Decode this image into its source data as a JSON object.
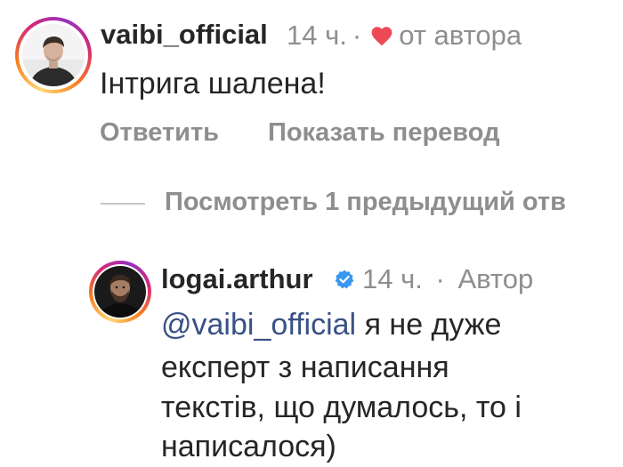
{
  "comments": [
    {
      "username": "vaibi_official",
      "time": "14 ч.",
      "separator": "·",
      "liked_by_author_label": "от автора",
      "text": "Інтрига шалена!",
      "actions": {
        "reply": "Ответить",
        "translate": "Показать перевод"
      },
      "avatar_icon": "user-avatar",
      "has_story_ring": true
    },
    {
      "username": "logai.arthur",
      "verified": true,
      "time": "14 ч.",
      "separator": "·",
      "author_label": "Автор",
      "mention": "@vaibi_official",
      "text_lines": [
        "я не дуже",
        "експерт з написання",
        "текстів, що думалось, то і",
        "написалося)"
      ],
      "avatar_icon": "user-avatar",
      "has_story_ring": true
    }
  ],
  "view_previous_replies": "Посмотреть 1 предыдущий отв",
  "icons": {
    "heart": "heart-icon",
    "verified": "verified-badge-icon"
  },
  "colors": {
    "heart": "#ed4956",
    "verified": "#3897f0",
    "mention": "#385185",
    "secondary_text": "#8e8e8e",
    "primary_text": "#262626"
  }
}
